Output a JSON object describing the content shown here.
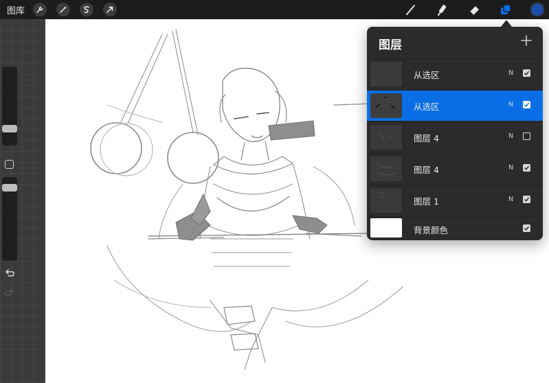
{
  "topbar": {
    "gallery_label": "图库",
    "left_tools": [
      {
        "icon": "wrench-icon"
      },
      {
        "icon": "magic-wand-icon"
      },
      {
        "icon": "selection-icon"
      },
      {
        "icon": "transform-arrow-icon"
      }
    ],
    "right_tools": [
      {
        "icon": "brush-icon"
      },
      {
        "icon": "smudge-icon"
      },
      {
        "icon": "eraser-icon"
      },
      {
        "icon": "layers-icon"
      }
    ],
    "current_color": "#1b4ea8"
  },
  "layers": {
    "title": "图层",
    "add_icon": "plus-icon",
    "accent_color": "#0a6fe6",
    "items": [
      {
        "name": "从选区",
        "blend": "N",
        "visible": true,
        "active": false
      },
      {
        "name": "从选区",
        "blend": "N",
        "visible": true,
        "active": true
      },
      {
        "name": "图层 4",
        "blend": "N",
        "visible": false,
        "active": false
      },
      {
        "name": "图层 4",
        "blend": "N",
        "visible": true,
        "active": false
      },
      {
        "name": "图层 1",
        "blend": "N",
        "visible": true,
        "active": false
      },
      {
        "name": "背景颜色",
        "blend": "",
        "visible": true,
        "active": false
      }
    ]
  }
}
